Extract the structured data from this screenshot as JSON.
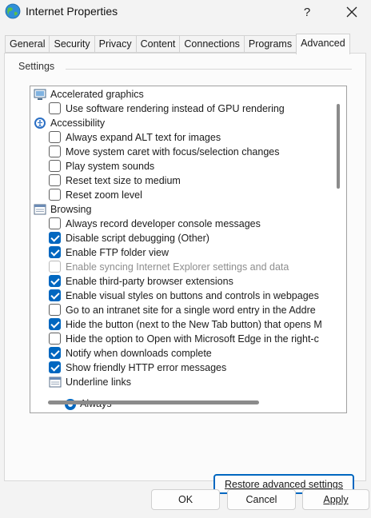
{
  "window": {
    "title": "Internet Properties",
    "help_label": "?"
  },
  "tabs": [
    {
      "label": "General"
    },
    {
      "label": "Security"
    },
    {
      "label": "Privacy"
    },
    {
      "label": "Content"
    },
    {
      "label": "Connections"
    },
    {
      "label": "Programs"
    },
    {
      "label": "Advanced",
      "active": true
    }
  ],
  "settings": {
    "group_label": "Settings",
    "items": [
      {
        "kind": "category",
        "label": "Accelerated graphics",
        "icon": "monitor-icon"
      },
      {
        "kind": "checkbox",
        "label": "Use software rendering instead of GPU rendering",
        "checked": false
      },
      {
        "kind": "category",
        "label": "Accessibility",
        "icon": "accessibility-icon"
      },
      {
        "kind": "checkbox",
        "label": "Always expand ALT text for images",
        "checked": false
      },
      {
        "kind": "checkbox",
        "label": "Move system caret with focus/selection changes",
        "checked": false
      },
      {
        "kind": "checkbox",
        "label": "Play system sounds",
        "checked": false
      },
      {
        "kind": "checkbox",
        "label": "Reset text size to medium",
        "checked": false
      },
      {
        "kind": "checkbox",
        "label": "Reset zoom level",
        "checked": false
      },
      {
        "kind": "category",
        "label": "Browsing",
        "icon": "page-icon"
      },
      {
        "kind": "checkbox",
        "label": "Always record developer console messages",
        "checked": false
      },
      {
        "kind": "checkbox",
        "label": "Disable script debugging (Other)",
        "checked": true
      },
      {
        "kind": "checkbox",
        "label": "Enable FTP folder view",
        "checked": true
      },
      {
        "kind": "checkbox",
        "label": "Enable syncing Internet Explorer settings and data",
        "checked": false,
        "disabled": true
      },
      {
        "kind": "checkbox",
        "label": "Enable third-party browser extensions",
        "checked": true
      },
      {
        "kind": "checkbox",
        "label": "Enable visual styles on buttons and controls in webpages",
        "checked": true
      },
      {
        "kind": "checkbox",
        "label": "Go to an intranet site for a single word entry in the Addre",
        "checked": false
      },
      {
        "kind": "checkbox",
        "label": "Hide the button (next to the New Tab button) that opens M",
        "checked": true
      },
      {
        "kind": "checkbox",
        "label": "Hide the option to Open with Microsoft Edge in the right-c",
        "checked": false
      },
      {
        "kind": "checkbox",
        "label": "Notify when downloads complete",
        "checked": true
      },
      {
        "kind": "checkbox",
        "label": "Show friendly HTTP error messages",
        "checked": true
      },
      {
        "kind": "subgroup",
        "label": "Underline links",
        "icon": "page-icon"
      },
      {
        "kind": "radio",
        "label": "Always",
        "checked": true
      }
    ]
  },
  "buttons": {
    "restore": "Restore advanced settings",
    "ok": "OK",
    "cancel": "Cancel",
    "apply": "Apply"
  },
  "colors": {
    "accent": "#0067c0"
  }
}
